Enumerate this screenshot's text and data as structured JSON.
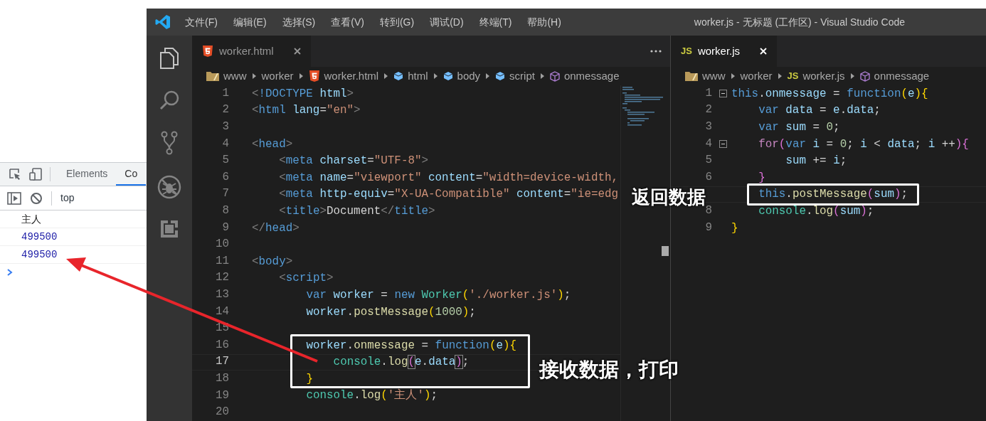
{
  "devtools": {
    "tabs": [
      {
        "label": "Elements",
        "selected": false
      },
      {
        "label": "Co",
        "selected": true
      }
    ],
    "context": "top",
    "messages": [
      {
        "text": "主人",
        "kind": "log"
      },
      {
        "text": "499500",
        "kind": "number"
      },
      {
        "text": "499500",
        "kind": "number"
      }
    ]
  },
  "vscode": {
    "menu": [
      "文件(F)",
      "编辑(E)",
      "选择(S)",
      "查看(V)",
      "转到(G)",
      "调试(D)",
      "终端(T)",
      "帮助(H)"
    ],
    "title": "worker.js - 无标题 (工作区) - Visual Studio Code"
  },
  "editors": [
    {
      "focused": false,
      "tab": {
        "label": "worker.html",
        "kind": "html"
      },
      "breadcrumbs": [
        {
          "label": "www",
          "kind": "folder"
        },
        {
          "label": "worker",
          "kind": "plain"
        },
        {
          "label": "worker.html",
          "kind": "html"
        },
        {
          "label": "html",
          "kind": "element"
        },
        {
          "label": "body",
          "kind": "element"
        },
        {
          "label": "script",
          "kind": "element"
        },
        {
          "label": "onmessage",
          "kind": "symbol"
        }
      ],
      "lines": [
        {
          "n": "1",
          "current": false,
          "code": [
            {
              "text": "<",
              "kind": "p"
            },
            {
              "text": "!DOCTYPE",
              "kind": "tag"
            },
            {
              "text": " html",
              "kind": "attr"
            },
            {
              "text": ">",
              "kind": "p"
            }
          ]
        },
        {
          "n": "2",
          "current": false,
          "code": [
            {
              "text": "<",
              "kind": "p"
            },
            {
              "text": "html",
              "kind": "tag"
            },
            {
              "text": " lang",
              "kind": "attr"
            },
            {
              "text": "=",
              "kind": "t"
            },
            {
              "text": "\"en\"",
              "kind": "str"
            },
            {
              "text": ">",
              "kind": "p"
            }
          ]
        },
        {
          "n": "3",
          "current": false
        },
        {
          "n": "4",
          "current": false,
          "code": [
            {
              "text": "<",
              "kind": "p"
            },
            {
              "text": "head",
              "kind": "tag"
            },
            {
              "text": ">",
              "kind": "p"
            }
          ],
          "children": [
            {
              "n": "5",
              "current": false,
              "code": [
                {
                  "text": "<",
                  "kind": "p"
                },
                {
                  "text": "meta",
                  "kind": "tag"
                },
                {
                  "text": " charset",
                  "kind": "attr"
                },
                {
                  "text": "=",
                  "kind": "t"
                },
                {
                  "text": "\"UTF-8\"",
                  "kind": "str"
                },
                {
                  "text": ">",
                  "kind": "p"
                }
              ]
            },
            {
              "n": "6",
              "current": false,
              "code": [
                {
                  "text": "<",
                  "kind": "p"
                },
                {
                  "text": "meta",
                  "kind": "tag"
                },
                {
                  "text": " name",
                  "kind": "attr"
                },
                {
                  "text": "=",
                  "kind": "t"
                },
                {
                  "text": "\"viewport\"",
                  "kind": "str"
                },
                {
                  "text": " content",
                  "kind": "attr"
                },
                {
                  "text": "=",
                  "kind": "t"
                },
                {
                  "text": "\"width=device-width,",
                  "kind": "str"
                }
              ]
            },
            {
              "n": "7",
              "current": false,
              "code": [
                {
                  "text": "<",
                  "kind": "p"
                },
                {
                  "text": "meta",
                  "kind": "tag"
                },
                {
                  "text": " http-equiv",
                  "kind": "attr"
                },
                {
                  "text": "=",
                  "kind": "t"
                },
                {
                  "text": "\"X-UA-Compatible\"",
                  "kind": "str"
                },
                {
                  "text": " content",
                  "kind": "attr"
                },
                {
                  "text": "=",
                  "kind": "t"
                },
                {
                  "text": "\"ie=edg",
                  "kind": "str"
                }
              ]
            },
            {
              "n": "8",
              "current": false,
              "code": [
                {
                  "text": "<",
                  "kind": "p"
                },
                {
                  "text": "title",
                  "kind": "tag"
                },
                {
                  "text": ">",
                  "kind": "p"
                },
                {
                  "text": "Document",
                  "kind": "t"
                },
                {
                  "text": "</",
                  "kind": "p"
                },
                {
                  "text": "title",
                  "kind": "tag"
                },
                {
                  "text": ">",
                  "kind": "p"
                }
              ]
            }
          ]
        },
        {
          "n": "9",
          "current": false,
          "code": [
            {
              "text": "</",
              "kind": "p"
            },
            {
              "text": "head",
              "kind": "tag"
            },
            {
              "text": ">",
              "kind": "p"
            }
          ]
        },
        {
          "n": "10",
          "current": false
        },
        {
          "n": "11",
          "current": false,
          "code": [
            {
              "text": "<",
              "kind": "p"
            },
            {
              "text": "body",
              "kind": "tag"
            },
            {
              "text": ">",
              "kind": "p"
            }
          ],
          "children": [
            {
              "n": "12",
              "current": false,
              "code": [
                {
                  "text": "<",
                  "kind": "p"
                },
                {
                  "text": "script",
                  "kind": "tag"
                },
                {
                  "text": ">",
                  "kind": "p"
                }
              ],
              "children": [
                {
                  "n": "13",
                  "current": false,
                  "code": [
                    {
                      "text": "var",
                      "kind": "kw"
                    },
                    {
                      "text": " worker",
                      "kind": "var"
                    },
                    {
                      "text": " = ",
                      "kind": "t"
                    },
                    {
                      "text": "new",
                      "kind": "kw"
                    },
                    {
                      "text": " Worker",
                      "kind": "cls"
                    },
                    {
                      "text": "(",
                      "kind": "b1"
                    },
                    {
                      "text": "'./worker.js'",
                      "kind": "str"
                    },
                    {
                      "text": ")",
                      "kind": "b1"
                    },
                    {
                      "text": ";",
                      "kind": "t"
                    }
                  ]
                },
                {
                  "n": "14",
                  "current": false,
                  "code": [
                    {
                      "text": "worker",
                      "kind": "var"
                    },
                    {
                      "text": ".",
                      "kind": "t"
                    },
                    {
                      "text": "postMessage",
                      "kind": "fn"
                    },
                    {
                      "text": "(",
                      "kind": "b1"
                    },
                    {
                      "text": "1000",
                      "kind": "num"
                    },
                    {
                      "text": ")",
                      "kind": "b1"
                    },
                    {
                      "text": ";",
                      "kind": "t"
                    }
                  ]
                },
                {
                  "n": "15",
                  "current": false
                },
                {
                  "n": "16",
                  "current": false,
                  "code": [
                    {
                      "text": "worker",
                      "kind": "var"
                    },
                    {
                      "text": ".",
                      "kind": "t"
                    },
                    {
                      "text": "onmessage",
                      "kind": "fn"
                    },
                    {
                      "text": " = ",
                      "kind": "t"
                    },
                    {
                      "text": "function",
                      "kind": "kw"
                    },
                    {
                      "text": "(",
                      "kind": "b1"
                    },
                    {
                      "text": "e",
                      "kind": "var"
                    },
                    {
                      "text": ")",
                      "kind": "b1"
                    },
                    {
                      "text": "{",
                      "kind": "b1"
                    }
                  ],
                  "children": [
                    {
                      "n": "17",
                      "current": true,
                      "code": [
                        {
                          "text": "console",
                          "kind": "cls"
                        },
                        {
                          "text": ".",
                          "kind": "t"
                        },
                        {
                          "text": "log",
                          "kind": "fn"
                        },
                        {
                          "text": "(",
                          "kind": "b2m"
                        },
                        {
                          "text": "e",
                          "kind": "var"
                        },
                        {
                          "text": ".",
                          "kind": "t"
                        },
                        {
                          "text": "data",
                          "kind": "var"
                        },
                        {
                          "text": ")",
                          "kind": "b2m"
                        },
                        {
                          "text": ";",
                          "kind": "t"
                        }
                      ]
                    }
                  ]
                },
                {
                  "n": "18",
                  "current": false,
                  "code": [
                    {
                      "text": "}",
                      "kind": "b1"
                    }
                  ]
                },
                {
                  "n": "19",
                  "current": false,
                  "code": [
                    {
                      "text": "console",
                      "kind": "cls"
                    },
                    {
                      "text": ".",
                      "kind": "t"
                    },
                    {
                      "text": "log",
                      "kind": "fn"
                    },
                    {
                      "text": "(",
                      "kind": "b1"
                    },
                    {
                      "text": "'主人'",
                      "kind": "str"
                    },
                    {
                      "text": ")",
                      "kind": "b1"
                    },
                    {
                      "text": ";",
                      "kind": "t"
                    }
                  ]
                },
                {
                  "n": "20",
                  "current": false
                }
              ]
            }
          ]
        }
      ]
    },
    {
      "focused": true,
      "tab": {
        "label": "worker.js",
        "kind": "js",
        "icon": "JS"
      },
      "breadcrumbs": [
        {
          "label": "www",
          "kind": "folder"
        },
        {
          "label": "worker",
          "kind": "plain"
        },
        {
          "label": "worker.js",
          "kind": "js",
          "icon": "JS"
        },
        {
          "label": "onmessage",
          "kind": "symbol"
        }
      ],
      "lines": [
        {
          "n": "1",
          "current": false,
          "fold": true,
          "code": [
            {
              "text": "this",
              "kind": "kw"
            },
            {
              "text": ".",
              "kind": "t"
            },
            {
              "text": "onmessage",
              "kind": "var"
            },
            {
              "text": " = ",
              "kind": "t"
            },
            {
              "text": "function",
              "kind": "kw"
            },
            {
              "text": "(",
              "kind": "b1"
            },
            {
              "text": "e",
              "kind": "var"
            },
            {
              "text": ")",
              "kind": "b1"
            },
            {
              "text": "{",
              "kind": "b1"
            }
          ],
          "children": [
            {
              "n": "2",
              "current": false,
              "fold": false,
              "code": [
                {
                  "text": "var",
                  "kind": "kw"
                },
                {
                  "text": " data",
                  "kind": "var"
                },
                {
                  "text": " = ",
                  "kind": "t"
                },
                {
                  "text": "e",
                  "kind": "var"
                },
                {
                  "text": ".",
                  "kind": "t"
                },
                {
                  "text": "data",
                  "kind": "var"
                },
                {
                  "text": ";",
                  "kind": "t"
                }
              ]
            },
            {
              "n": "3",
              "current": false,
              "fold": false,
              "code": [
                {
                  "text": "var",
                  "kind": "kw"
                },
                {
                  "text": " sum",
                  "kind": "var"
                },
                {
                  "text": " = ",
                  "kind": "t"
                },
                {
                  "text": "0",
                  "kind": "num"
                },
                {
                  "text": ";",
                  "kind": "t"
                }
              ]
            },
            {
              "n": "4",
              "current": false,
              "fold": true,
              "code": [
                {
                  "text": "for",
                  "kind": "ctl"
                },
                {
                  "text": "(",
                  "kind": "b2"
                },
                {
                  "text": "var",
                  "kind": "kw"
                },
                {
                  "text": " i",
                  "kind": "var"
                },
                {
                  "text": " = ",
                  "kind": "t"
                },
                {
                  "text": "0",
                  "kind": "num"
                },
                {
                  "text": "; ",
                  "kind": "t"
                },
                {
                  "text": "i",
                  "kind": "var"
                },
                {
                  "text": " < ",
                  "kind": "t"
                },
                {
                  "text": "data",
                  "kind": "var"
                },
                {
                  "text": "; ",
                  "kind": "t"
                },
                {
                  "text": "i",
                  "kind": "var"
                },
                {
                  "text": " ++",
                  "kind": "t"
                },
                {
                  "text": ")",
                  "kind": "b2"
                },
                {
                  "text": "{",
                  "kind": "b2"
                }
              ],
              "children": [
                {
                  "n": "5",
                  "current": false,
                  "fold": false,
                  "code": [
                    {
                      "text": "sum",
                      "kind": "var"
                    },
                    {
                      "text": " += ",
                      "kind": "t"
                    },
                    {
                      "text": "i",
                      "kind": "var"
                    },
                    {
                      "text": ";",
                      "kind": "t"
                    }
                  ]
                }
              ]
            },
            {
              "n": "6",
              "current": false,
              "fold": false,
              "code": [
                {
                  "text": "}",
                  "kind": "b2"
                }
              ]
            },
            {
              "current": true,
              "fold": false,
              "code": [
                {
                  "text": "this",
                  "kind": "kw"
                },
                {
                  "text": ".",
                  "kind": "t"
                },
                {
                  "text": "postMessage",
                  "kind": "fn"
                },
                {
                  "text": "(",
                  "kind": "b2"
                },
                {
                  "text": "sum",
                  "kind": "var"
                },
                {
                  "text": ")",
                  "kind": "b2"
                },
                {
                  "text": ";",
                  "kind": "t"
                }
              ]
            },
            {
              "n": "8",
              "current": false,
              "fold": false,
              "code": [
                {
                  "text": "console",
                  "kind": "cls"
                },
                {
                  "text": ".",
                  "kind": "t"
                },
                {
                  "text": "log",
                  "kind": "fn"
                },
                {
                  "text": "(",
                  "kind": "b2"
                },
                {
                  "text": "sum",
                  "kind": "var"
                },
                {
                  "text": ")",
                  "kind": "b2"
                },
                {
                  "text": ";",
                  "kind": "t"
                }
              ]
            }
          ]
        },
        {
          "n": "9",
          "current": false,
          "fold": false,
          "code": [
            {
              "text": "}",
              "kind": "b1"
            }
          ]
        }
      ]
    }
  ],
  "annotations": [
    {
      "text": "返回数据"
    },
    {
      "text": "接收数据，打印"
    }
  ]
}
